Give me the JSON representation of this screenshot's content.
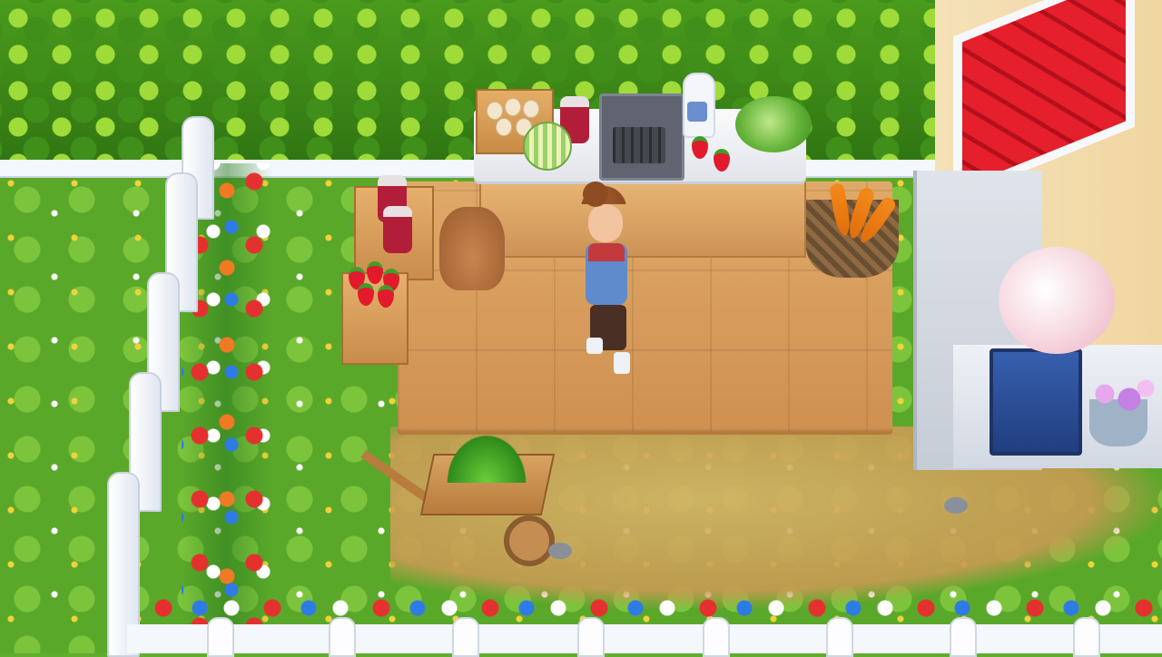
{
  "scene": {
    "name": "farm-garden-kitchen",
    "character": "player-character",
    "objects": [
      "hedge",
      "white-picket-fence",
      "outdoor-kitchen-counter",
      "stove",
      "egg-crate",
      "jam-jar",
      "milk-bottle",
      "cabbage",
      "melon",
      "strawberries",
      "sack",
      "jam-crate",
      "strawberry-crate",
      "vegetable-basket",
      "wooden-floor",
      "wheelbarrow",
      "house",
      "potted-blossom-tree",
      "small-flower-pot",
      "dirt-path"
    ]
  },
  "colors": {
    "grass": "#5aa82a",
    "hedge": "#3f8f1a",
    "floor": "#d9a064",
    "fence": "#f4f7fb",
    "roof": "#e51f2b",
    "pot": "#2f52a0"
  }
}
